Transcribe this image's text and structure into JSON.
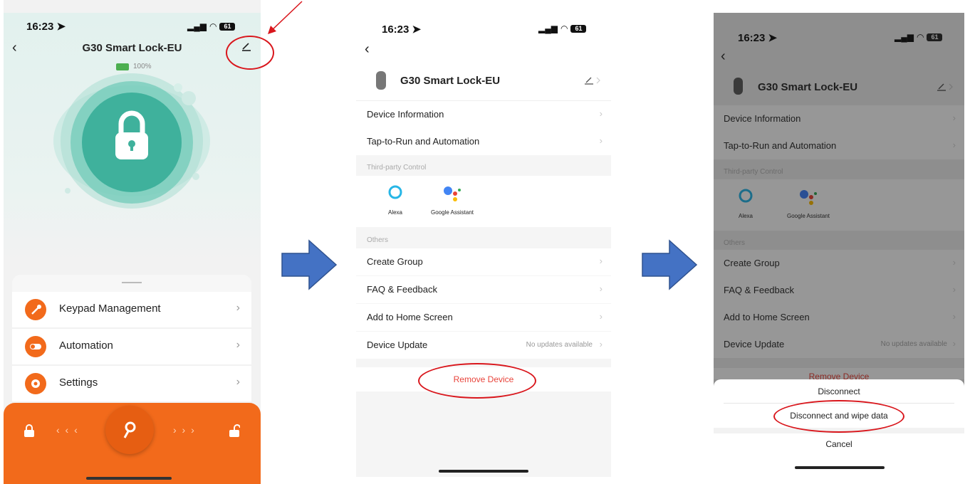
{
  "colors": {
    "accent": "#f26a1b",
    "teal": "#41b9a5",
    "danger": "#e8443b",
    "highlight": "#d9161c",
    "arrow": "#4472c4"
  },
  "status_bar": {
    "time": "16:23",
    "battery": "61"
  },
  "screen1": {
    "title": "G30 Smart Lock-EU",
    "battery_level": "100%",
    "menu": [
      {
        "label": "Keypad Management",
        "icon": "key-icon"
      },
      {
        "label": "Automation",
        "icon": "toggle-icon"
      },
      {
        "label": "Settings",
        "icon": "gear-icon"
      }
    ],
    "bottom_bar": {
      "left_arrows": "‹ ‹ ‹",
      "right_arrows": "› › ›"
    }
  },
  "screen2": {
    "device_name": "G30 Smart Lock-EU",
    "rows_top": [
      "Device Information",
      "Tap-to-Run and Automation"
    ],
    "third_party_label": "Third-party Control",
    "alexa_label": "Alexa",
    "google_label": "Google Assistant",
    "others_label": "Others",
    "rows_others": [
      "Create Group",
      "FAQ & Feedback",
      "Add to Home Screen",
      "Device Update"
    ],
    "update_status": "No updates available",
    "remove_label": "Remove Device"
  },
  "screen3": {
    "device_name": "G30 Smart Lock-EU",
    "rows_top": [
      "Device Information",
      "Tap-to-Run and Automation"
    ],
    "third_party_label": "Third-party Control",
    "alexa_label": "Alexa",
    "google_label": "Google Assistant",
    "others_label": "Others",
    "rows_others": [
      "Create Group",
      "FAQ & Feedback",
      "Add to Home Screen",
      "Device Update"
    ],
    "update_status": "No updates available",
    "remove_label": "Remove Device",
    "sheet": {
      "disconnect": "Disconnect",
      "wipe": "Disconnect and wipe data",
      "cancel": "Cancel"
    }
  }
}
